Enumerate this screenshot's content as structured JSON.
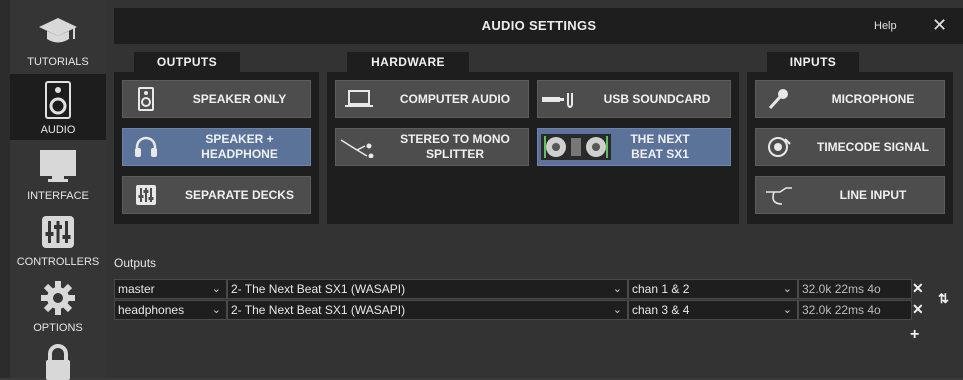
{
  "sidebar": {
    "items": [
      {
        "label": "TUTORIALS",
        "icon": "graduation-cap-icon"
      },
      {
        "label": "AUDIO",
        "icon": "speaker-icon"
      },
      {
        "label": "INTERFACE",
        "icon": "monitor-icon"
      },
      {
        "label": "CONTROLLERS",
        "icon": "sliders-icon"
      },
      {
        "label": "OPTIONS",
        "icon": "gear-icon"
      },
      {
        "label": "",
        "icon": "lock-icon"
      }
    ],
    "active": "AUDIO"
  },
  "dialog": {
    "title": "AUDIO SETTINGS",
    "help_label": "Help",
    "close_glyph": "✕"
  },
  "sections": {
    "outputs": {
      "tab": "OUTPUTS",
      "buttons": [
        {
          "label": "SPEAKER ONLY",
          "icon": "speaker-icon",
          "selected": false
        },
        {
          "label": "SPEAKER + HEADPHONE",
          "icon": "headphone-icon",
          "selected": true
        },
        {
          "label": "SEPARATE DECKS",
          "icon": "mixer-icon",
          "selected": false
        }
      ]
    },
    "hardware": {
      "tab": "HARDWARE",
      "buttons": [
        {
          "label": "COMPUTER AUDIO",
          "icon": "laptop-icon",
          "selected": false
        },
        {
          "label": "USB SOUNDCARD",
          "icon": "usb-soundcard-icon",
          "selected": false
        },
        {
          "label": "STEREO TO MONO SPLITTER",
          "icon": "splitter-cable-icon",
          "selected": false
        },
        {
          "label": "THE NEXT BEAT SX1",
          "icon": "controller-thumbnail-icon",
          "selected": true
        }
      ]
    },
    "inputs": {
      "tab": "INPUTS",
      "buttons": [
        {
          "label": "MICROPHONE",
          "icon": "microphone-icon",
          "selected": false
        },
        {
          "label": "TIMECODE SIGNAL",
          "icon": "vinyl-icon",
          "selected": false
        },
        {
          "label": "LINE INPUT",
          "icon": "cable-jack-icon",
          "selected": false
        }
      ]
    }
  },
  "outputs_table": {
    "label": "Outputs",
    "rows": [
      {
        "name": "master",
        "device": "2- The Next Beat SX1 (WASAPI)",
        "channels": "chan 1 & 2",
        "info": "32.0k 22ms 4o"
      },
      {
        "name": "headphones",
        "device": "2- The Next Beat SX1 (WASAPI)",
        "channels": "chan 3 & 4",
        "info": "32.0k 22ms 4o"
      }
    ],
    "remove_glyph": "✕",
    "add_glyph": "+",
    "swap_glyph": "⇅"
  },
  "colors": {
    "accent_selected": "#5b7299",
    "panel_bg": "#1e1e1e",
    "button_bg": "#4d4d4d"
  }
}
